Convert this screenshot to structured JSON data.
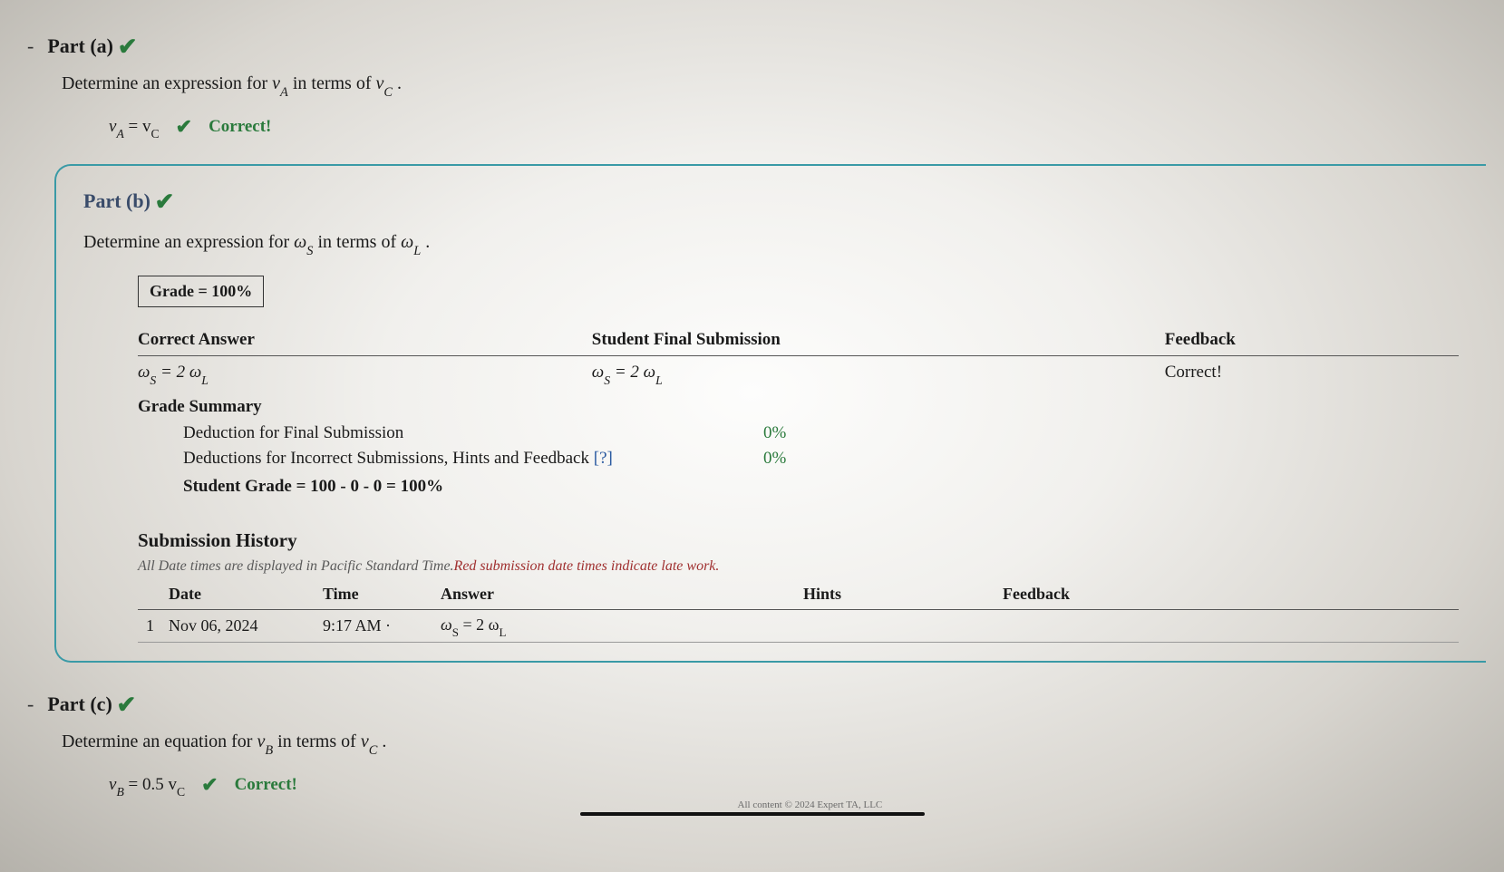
{
  "part_a": {
    "title": "Part (a)",
    "prompt_prefix": "Determine an expression for ",
    "prompt_sym1_base": "v",
    "prompt_sym1_sub": "A",
    "prompt_mid": " in terms of ",
    "prompt_sym2_base": "v",
    "prompt_sym2_sub": "C",
    "prompt_suffix": " .",
    "answer_lhs_base": "v",
    "answer_lhs_sub": "A",
    "answer_eq": " = ",
    "answer_rhs_base": "v",
    "answer_rhs_sub": "C",
    "correct_label": "Correct!"
  },
  "part_b": {
    "title": "Part (b)",
    "prompt_prefix": "Determine an expression for ",
    "prompt_sym1_base": "ω",
    "prompt_sym1_sub": "S",
    "prompt_mid": " in terms of ",
    "prompt_sym2_base": "ω",
    "prompt_sym2_sub": "L",
    "prompt_suffix": " .",
    "grade_box": "Grade = 100%",
    "headers": {
      "correct_answer": "Correct Answer",
      "student_final": "Student Final Submission",
      "feedback": "Feedback"
    },
    "correct_answer_text": "ωS = 2 ωL",
    "student_answer_text": "ωS = 2 ωL",
    "feedback_text": "Correct!",
    "grade_summary_label": "Grade Summary",
    "deduction_final_label": "Deduction for Final Submission",
    "deduction_final_pct": "0%",
    "deduction_incorrect_label_a": "Deductions for Incorrect Submissions, Hints and Feedback ",
    "deduction_incorrect_help": "[?]",
    "deduction_incorrect_pct": "0%",
    "student_grade_line": "Student Grade = 100 - 0 - 0 = 100%",
    "history_title": "Submission History",
    "history_note_a": "All Date times are displayed in Pacific Standard Time.",
    "history_note_b": "Red submission date times indicate late work.",
    "history_headers": {
      "blank": "",
      "date": "Date",
      "time": "Time",
      "answer": "Answer",
      "hints": "Hints",
      "feedback": "Feedback"
    },
    "history_rows": [
      {
        "idx": "1",
        "date": "Nov 06, 2024",
        "time": "9:17 AM  ·",
        "answer": "ωS = 2 ωL",
        "hints": "",
        "feedback": ""
      }
    ]
  },
  "part_c": {
    "title": "Part (c)",
    "prompt_prefix": "Determine an equation for ",
    "prompt_sym1_base": "v",
    "prompt_sym1_sub": "B",
    "prompt_mid": " in terms of ",
    "prompt_sym2_base": "v",
    "prompt_sym2_sub": "C",
    "prompt_suffix": " .",
    "answer_lhs_base": "v",
    "answer_lhs_sub": "B",
    "answer_eq": " = 0.5 ",
    "answer_rhs_base": "v",
    "answer_rhs_sub": "C",
    "correct_label": "Correct!"
  },
  "footer": "All content © 2024 Expert TA, LLC"
}
